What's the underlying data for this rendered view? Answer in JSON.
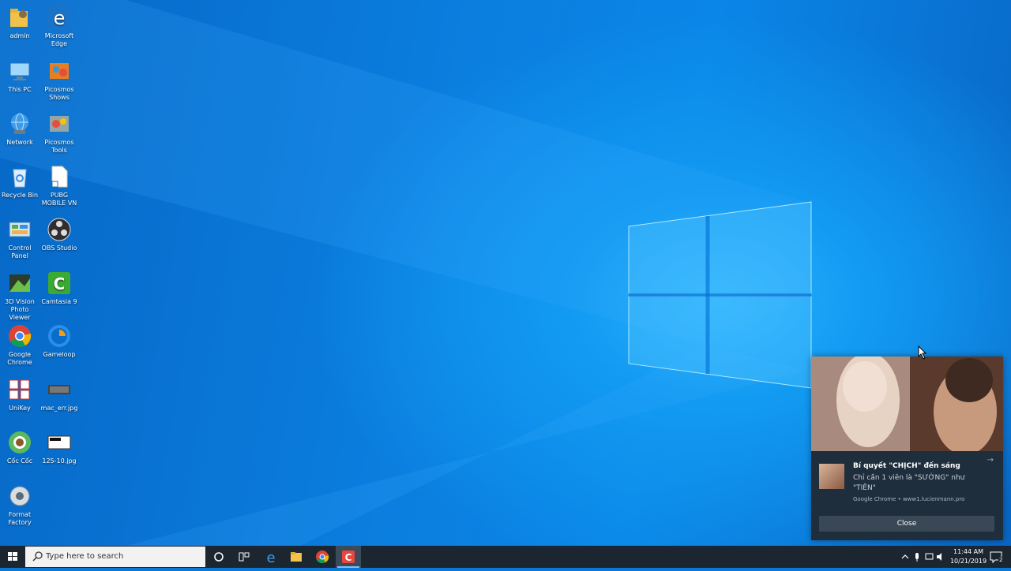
{
  "desktop": {
    "icons": [
      {
        "label": "admin",
        "icon": "user-folder-icon"
      },
      {
        "label": "Microsoft Edge",
        "icon": "edge-icon"
      },
      {
        "label": "This PC",
        "icon": "computer-icon"
      },
      {
        "label": "Picosmos Shows",
        "icon": "picosmos-icon"
      },
      {
        "label": "Network",
        "icon": "network-icon"
      },
      {
        "label": "Picosmos Tools",
        "icon": "picosmos-tools-icon"
      },
      {
        "label": "Recycle Bin",
        "icon": "recycle-bin-icon"
      },
      {
        "label": "PUBG MOBILE VN",
        "icon": "file-shortcut-icon"
      },
      {
        "label": "Control Panel",
        "icon": "control-panel-icon"
      },
      {
        "label": "OBS Studio",
        "icon": "obs-icon"
      },
      {
        "label": "3D Vision Photo Viewer",
        "icon": "3d-vision-icon"
      },
      {
        "label": "Camtasia 9",
        "icon": "camtasia-icon"
      },
      {
        "label": "Google Chrome",
        "icon": "chrome-icon"
      },
      {
        "label": "Gameloop",
        "icon": "gameloop-icon"
      },
      {
        "label": "UniKey",
        "icon": "unikey-icon"
      },
      {
        "label": "mac_err.jpg",
        "icon": "image-file-icon"
      },
      {
        "label": "Cốc Cốc",
        "icon": "coccoc-icon"
      },
      {
        "label": "125-10.jpg",
        "icon": "image-file-icon"
      },
      {
        "label": "Format Factory",
        "icon": "format-factory-icon"
      }
    ]
  },
  "notification": {
    "title": "Bí quyết \"CHỊCH\" đến sáng",
    "body": "Chỉ cần 1 viên là \"SƯỚNG\" như \"TIÊN\"",
    "source": "Google Chrome • www1.lucienmann.pro",
    "close_label": "Close"
  },
  "taskbar": {
    "search_placeholder": "Type here to search",
    "time": "11:44 AM",
    "date": "10/21/2019",
    "notification_count": "2",
    "apps": [
      "cortana-icon",
      "task-view-icon",
      "edge-icon",
      "file-explorer-icon",
      "chrome-icon",
      "camtasia-icon"
    ]
  },
  "colors": {
    "taskbar": "#1c2631",
    "toast": "#1f2e3c",
    "accent": "#7cc0ff"
  }
}
